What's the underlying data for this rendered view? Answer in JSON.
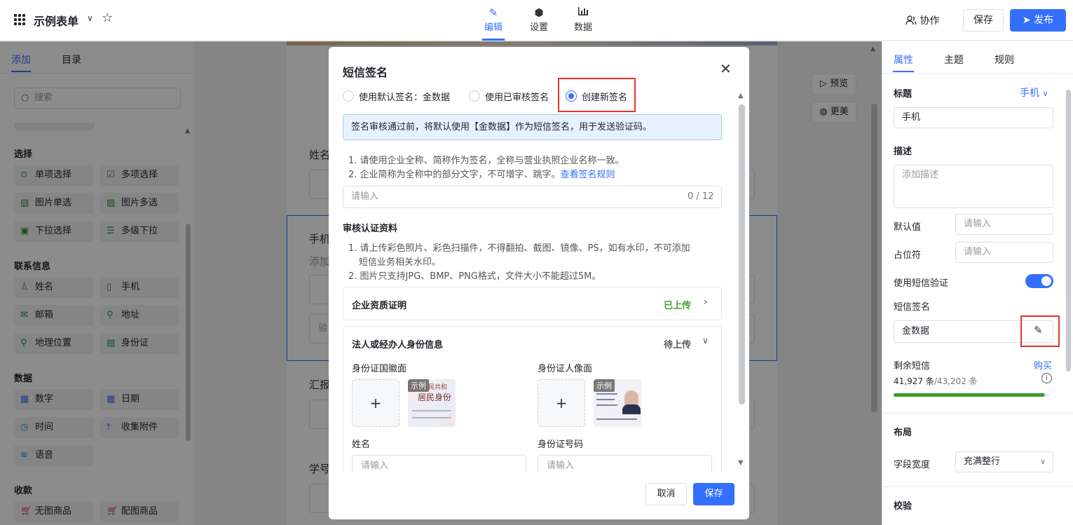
{
  "topbar": {
    "app_title": "示例表单",
    "tabs": [
      {
        "label": "编辑",
        "icon": "pen-icon"
      },
      {
        "label": "设置",
        "icon": "hexagon-gear-icon"
      },
      {
        "label": "数据",
        "icon": "bar-chart-icon"
      }
    ],
    "collab_label": "协作",
    "save_label": "保存",
    "publish_label": "发布"
  },
  "left": {
    "tabs": [
      "添加",
      "目录"
    ],
    "search_placeholder": "搜索",
    "sections": [
      {
        "title": "选择",
        "items": [
          "单项选择",
          "多项选择",
          "图片单选",
          "图片多选",
          "下拉选择",
          "多级下拉"
        ]
      },
      {
        "title": "联系信息",
        "items": [
          "姓名",
          "手机",
          "邮箱",
          "地址",
          "地理位置",
          "身份证"
        ]
      },
      {
        "title": "数据",
        "items": [
          "数字",
          "日期",
          "时间",
          "收集附件",
          "语音"
        ]
      },
      {
        "title": "收款",
        "items": [
          "无图商品",
          "配图商品"
        ]
      }
    ]
  },
  "canvas": {
    "labels": [
      "姓名",
      "手机",
      "添加",
      "验",
      "汇报",
      "学号"
    ],
    "side_buttons": [
      "预览",
      "更美"
    ]
  },
  "right": {
    "tabs": [
      "属性",
      "主题",
      "规则"
    ],
    "title_label": "标题",
    "title_type": "手机",
    "title_value": "手机",
    "desc_label": "描述",
    "desc_placeholder": "添加描述",
    "default_label": "默认值",
    "default_placeholder": "请输入",
    "placeholder_label": "占位符",
    "placeholder_placeholder": "请输入",
    "sms_verify_label": "使用短信验证",
    "sms_sign_label": "短信签名",
    "sms_sign_value": "金数据",
    "remaining_label": "剩余短信",
    "buy_label": "购买",
    "remaining_count": "41,927 条",
    "remaining_total": "/43,202 条",
    "remaining_fraction": 0.97,
    "layout_label": "布局",
    "width_label": "字段宽度",
    "width_value": "充满整行",
    "validate_label": "校验"
  },
  "modal": {
    "title": "短信签名",
    "radio_options": [
      "使用默认签名：金数据",
      "使用已审核签名",
      "创建新签名"
    ],
    "selected_option": 2,
    "info": "签名审核通过前，将默认使用【金数据】作为短信签名，用于发送验证码。",
    "rules": [
      "1. 请使用企业全称、简称作为签名，全称与营业执照企业名称一致。",
      "2. 企业简称为全称中的部分文字，不可增字、跳字。"
    ],
    "rules_link": "查看签名规则",
    "sign_placeholder": "请输入",
    "sign_count": "0 / 12",
    "audit_title": "审核认证资料",
    "audit_rules": [
      "1. 请上传彩色照片、彩色扫描件，不得翻拍、截图、镜像、PS，如有水印，不可添加",
      "短信业务相关水印。",
      "2. 图片只支持JPG、BMP、PNG格式，文件大小不能超过5M。"
    ],
    "card1_title": "企业资质证明",
    "card1_status": "已上传",
    "card2_title": "法人或经办人身份信息",
    "card2_status": "待上传",
    "id_front_label": "身份证国徽面",
    "id_back_label": "身份证人像面",
    "sample_tag": "示例",
    "id_front_text_1": "中华人民共和",
    "id_front_text_2": "居民身份",
    "name_label": "姓名",
    "name_placeholder": "请输入",
    "idno_label": "身份证号码",
    "idno_placeholder": "请输入",
    "cancel_label": "取消",
    "save_label": "保存"
  }
}
